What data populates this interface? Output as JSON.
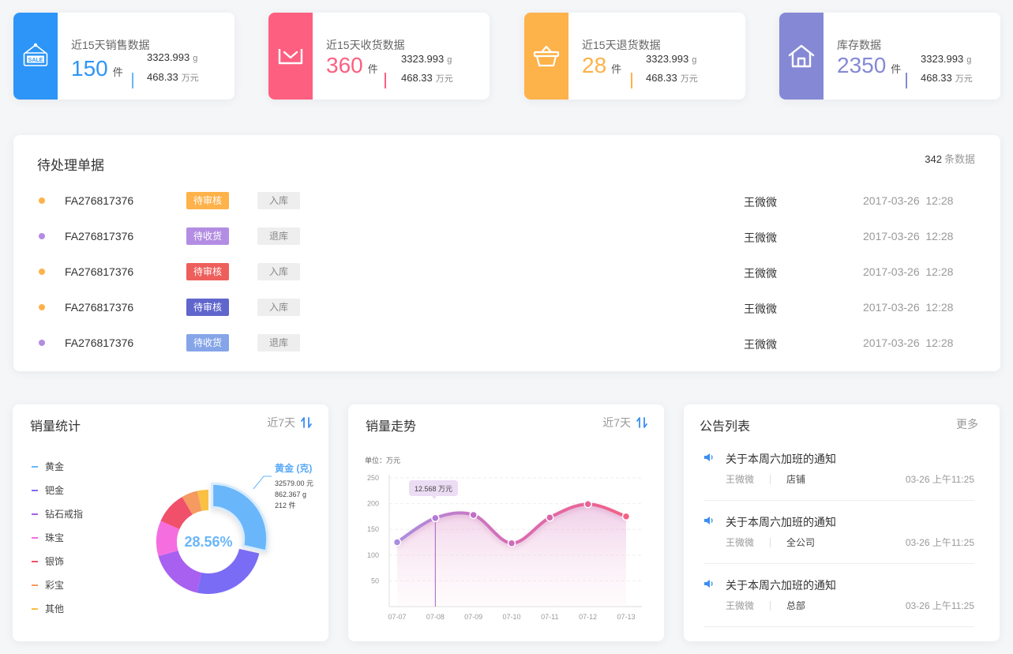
{
  "stats": [
    {
      "title": "近15天销售数据",
      "count": "150",
      "unit": "件",
      "weight": "3323.993",
      "weight_unit": "g",
      "money": "468.33",
      "money_unit": "万元",
      "color": "#2d95f7",
      "icon": "sale-sign-icon"
    },
    {
      "title": "近15天收货数据",
      "count": "360",
      "unit": "件",
      "weight": "3323.993",
      "weight_unit": "g",
      "money": "468.33",
      "money_unit": "万元",
      "color": "#fd5f80",
      "icon": "inbox-download-icon"
    },
    {
      "title": "近15天退货数据",
      "count": "28",
      "unit": "件",
      "weight": "3323.993",
      "weight_unit": "g",
      "money": "468.33",
      "money_unit": "万元",
      "color": "#fdb24a",
      "icon": "basket-icon"
    },
    {
      "title": "库存数据",
      "count": "2350",
      "unit": "件",
      "weight": "3323.993",
      "weight_unit": "g",
      "money": "468.33",
      "money_unit": "万元",
      "color": "#8589d5",
      "icon": "house-icon"
    }
  ],
  "pending": {
    "title": "待处理单据",
    "count": "342",
    "count_suffix": "条数据",
    "rows": [
      {
        "dot_color": "#fdb24a",
        "code": "FA276817376",
        "status": "待审核",
        "status_color": "#fdb24a",
        "type": "入库",
        "person": "王微微",
        "date": "2017-03-26  12:28"
      },
      {
        "dot_color": "#b38de3",
        "code": "FA276817376",
        "status": "待收货",
        "status_color": "#b38de3",
        "type": "退库",
        "person": "王微微",
        "date": "2017-03-26  12:28"
      },
      {
        "dot_color": "#fdb24a",
        "code": "FA276817376",
        "status": "待审核",
        "status_color": "#ee5f5b",
        "type": "入库",
        "person": "王微微",
        "date": "2017-03-26  12:28"
      },
      {
        "dot_color": "#fdb24a",
        "code": "FA276817376",
        "status": "待审核",
        "status_color": "#6066cc",
        "type": "入库",
        "person": "王微微",
        "date": "2017-03-26  12:28"
      },
      {
        "dot_color": "#b38de3",
        "code": "FA276817376",
        "status": "待收货",
        "status_color": "#86a5e8",
        "type": "退库",
        "person": "王微微",
        "date": "2017-03-26  12:28"
      }
    ]
  },
  "sales_stats": {
    "title": "销量统计",
    "range": "近7天",
    "center_label": "28.56%",
    "callout": {
      "title": "黄金 (克)",
      "line1": "32579.00 元",
      "line2": "862.367 g",
      "line3": "212 件"
    }
  },
  "sales_trend": {
    "title": "销量走势",
    "range": "近7天",
    "unit_label": "单位：万元",
    "tooltip": "12.568 万元"
  },
  "notices": {
    "title": "公告列表",
    "more": "更多",
    "items": [
      {
        "title": "关于本周六加班的通知",
        "author": "王微微",
        "dept": "店铺",
        "time": "03-26  上午11:25"
      },
      {
        "title": "关于本周六加班的通知",
        "author": "王微微",
        "dept": "全公司",
        "time": "03-26  上午11:25"
      },
      {
        "title": "关于本周六加班的通知",
        "author": "王微微",
        "dept": "总部",
        "time": "03-26  上午11:25"
      }
    ]
  },
  "chart_data": [
    {
      "type": "pie",
      "categories": [
        "黄金",
        "钯金",
        "钻石戒指",
        "珠宝",
        "银饰",
        "彩宝",
        "其他"
      ],
      "values": [
        28.56,
        25.0,
        17.0,
        11.0,
        10.0,
        5.0,
        3.44
      ],
      "colors": [
        "#6ab6fa",
        "#7b6cf6",
        "#a860f0",
        "#f56ee0",
        "#f0506a",
        "#f59a60",
        "#f9c043"
      ],
      "donut": true
    },
    {
      "type": "area",
      "x": [
        "07-07",
        "07-08",
        "07-09",
        "07-10",
        "07-11",
        "07-12",
        "07-13"
      ],
      "y_ticks": [
        50,
        100,
        150,
        200,
        250
      ],
      "ylim": [
        0,
        250
      ],
      "points": [
        [
          0,
          125
        ],
        [
          1,
          172
        ],
        [
          2,
          178
        ],
        [
          3,
          123
        ],
        [
          4,
          173
        ],
        [
          5,
          199
        ],
        [
          6,
          175
        ]
      ],
      "highlight_index": 1
    }
  ]
}
